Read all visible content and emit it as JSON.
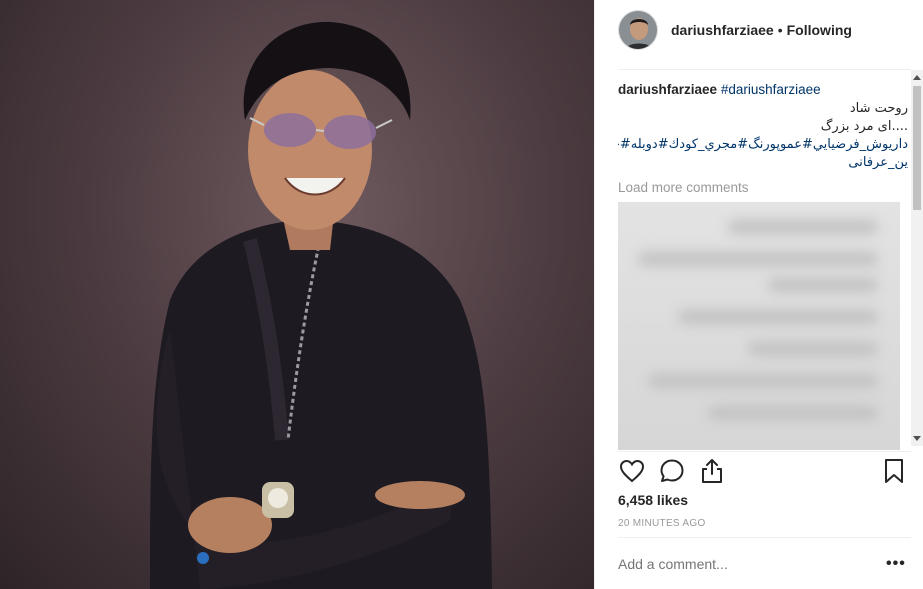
{
  "post": {
    "username": "dariushfarziaee",
    "separator": "•",
    "follow_status": "Following",
    "caption": {
      "username": "dariushfarziaee",
      "hashtag": "#dariushfarziaee",
      "line_fa_1": "روحت شاد",
      "line_fa_2": "....ای مرد بزرگ",
      "line_fa_3": "داريوش_فرضيايي#عموپورنگ#مجري_كودك#دوبله#حس#",
      "line_fa_4": "ين_عرفانی"
    },
    "load_more": "Load more comments",
    "likes": "6,458 likes",
    "timestamp": "20 MINUTES AGO",
    "comment_placeholder": "Add a comment...",
    "more_label": "•••"
  },
  "icons": {
    "like": "heart-icon",
    "comment": "comment-bubble-icon",
    "share": "share-icon",
    "save": "bookmark-icon",
    "more": "more-options-icon"
  },
  "colors": {
    "text": "#262626",
    "hashtag": "#003569",
    "muted": "#999999",
    "divider": "#efefef"
  }
}
